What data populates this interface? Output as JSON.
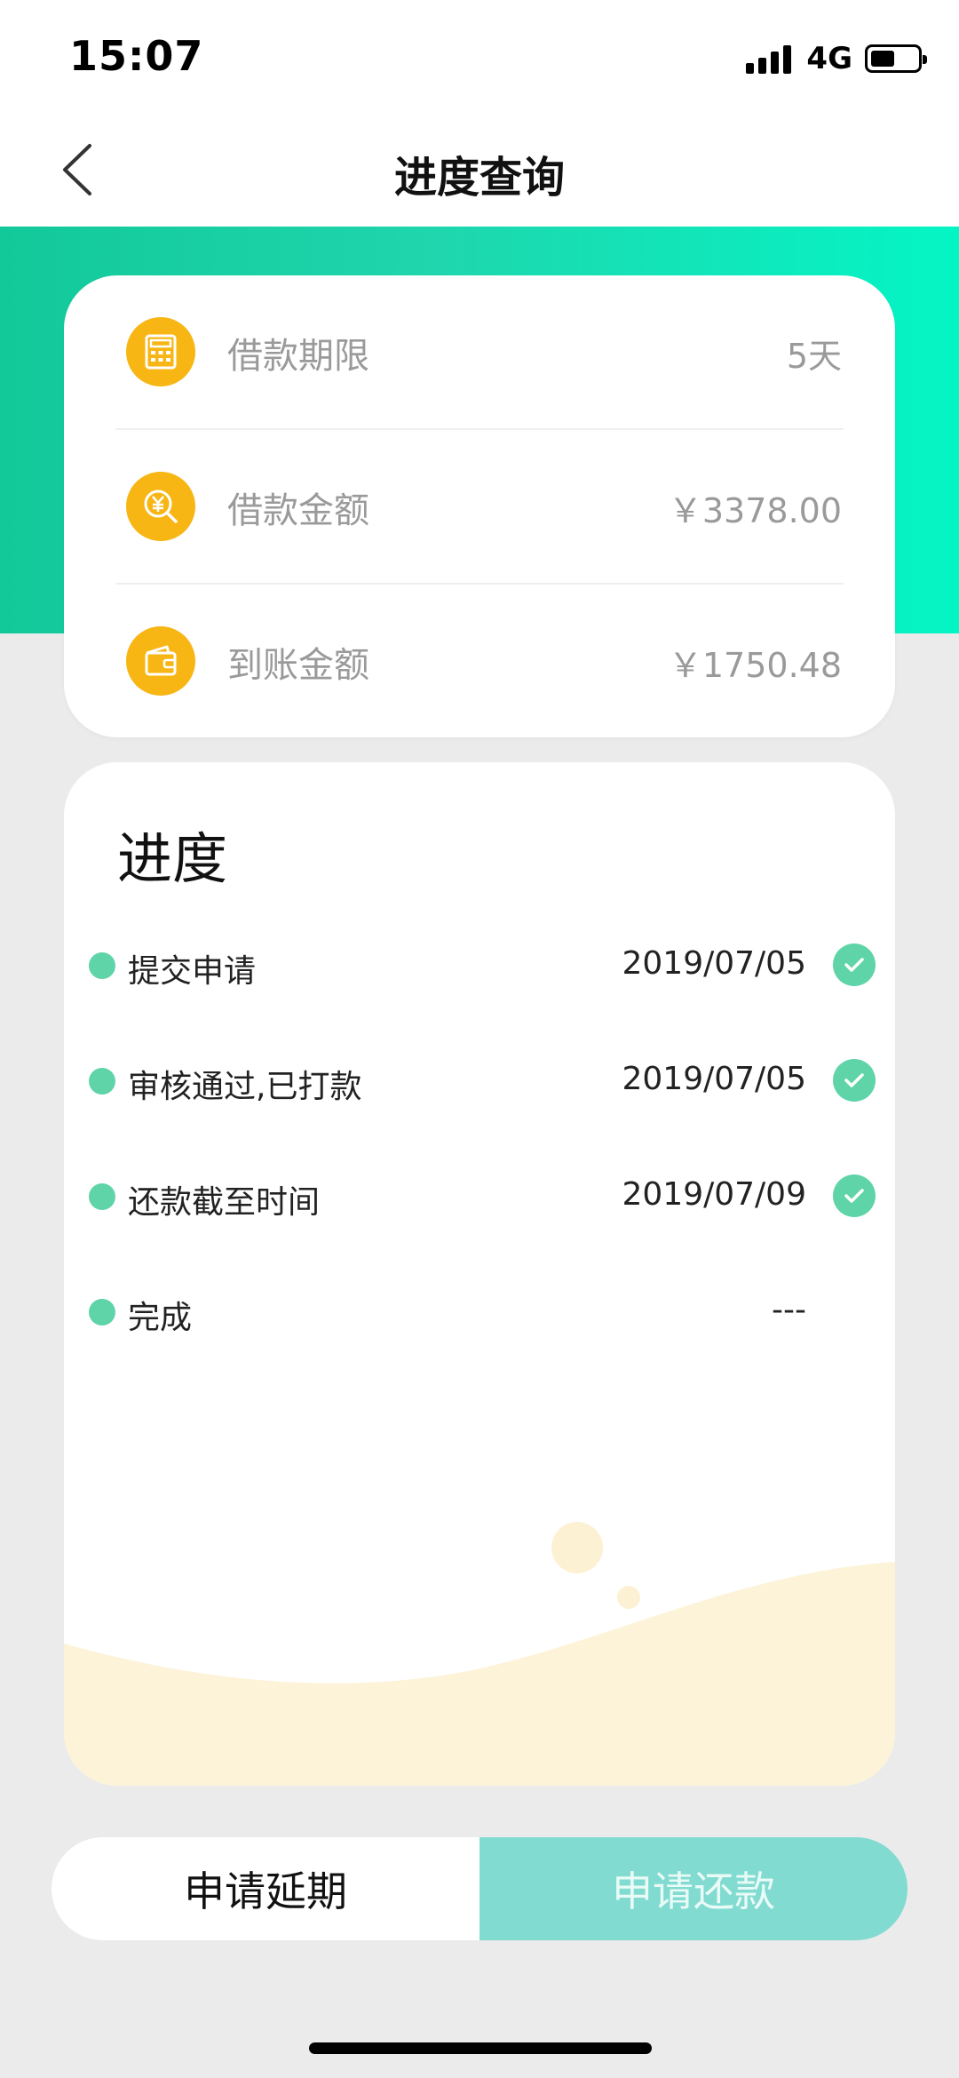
{
  "status_bar": {
    "time": "15:07",
    "network": "4G"
  },
  "nav": {
    "title": "进度查询",
    "back_icon": "chevron-left-icon"
  },
  "colors": {
    "banner_start": "#12c99a",
    "banner_end": "#04f5c5",
    "icon_accent": "#f7b614",
    "step_green": "#5ed4a8",
    "repay_button": "#81dbd0"
  },
  "loan_info": [
    {
      "icon": "calculator-icon",
      "label": "借款期限",
      "value": "5天"
    },
    {
      "icon": "yuan-search-icon",
      "label": "借款金额",
      "value": "￥3378.00"
    },
    {
      "icon": "wallet-icon",
      "label": "到账金额",
      "value": "￥1750.48"
    }
  ],
  "progress": {
    "title": "进度",
    "steps": [
      {
        "label": "提交申请",
        "date": "2019/07/05",
        "done": true
      },
      {
        "label": "审核通过,已打款",
        "date": "2019/07/05",
        "done": true
      },
      {
        "label": "还款截至时间",
        "date": "2019/07/09",
        "done": true
      },
      {
        "label": "完成",
        "date": "---",
        "done": false
      }
    ]
  },
  "buttons": {
    "extend_label": "申请延期",
    "repay_label": "申请还款"
  }
}
